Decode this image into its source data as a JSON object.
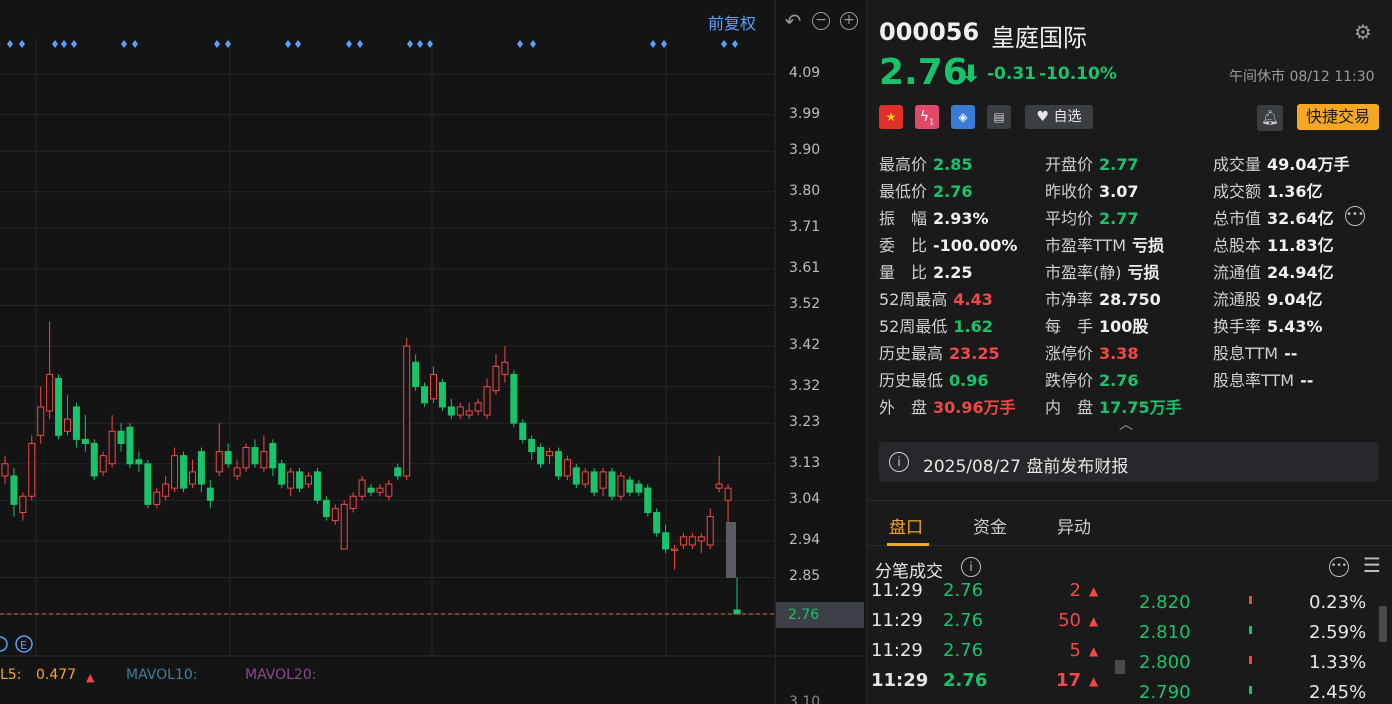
{
  "toolbar": {
    "adjust_label": "前复权",
    "undo_icon": "undo-icon",
    "zoom_out_icon": "zoom-out-icon",
    "zoom_in_icon": "zoom-in-icon"
  },
  "chart_data": {
    "type": "candlestick",
    "title": "",
    "y_ticks": [
      "4.09",
      "3.99",
      "3.90",
      "3.80",
      "3.71",
      "3.61",
      "3.52",
      "3.42",
      "3.32",
      "3.23",
      "3.13",
      "3.04",
      "2.94",
      "2.85",
      "2.76"
    ],
    "ylim": [
      2.76,
      4.09
    ],
    "current_price_label": "2.76",
    "partial_low_label": "3.10",
    "candles": [
      {
        "o": 3.1,
        "c": 3.13,
        "h": 3.15,
        "l": 3.08
      },
      {
        "o": 3.1,
        "c": 3.03,
        "h": 3.12,
        "l": 3.0
      },
      {
        "o": 3.01,
        "c": 3.05,
        "h": 3.06,
        "l": 2.99
      },
      {
        "o": 3.05,
        "c": 3.18,
        "h": 3.2,
        "l": 3.04
      },
      {
        "o": 3.2,
        "c": 3.27,
        "h": 3.32,
        "l": 3.18
      },
      {
        "o": 3.26,
        "c": 3.35,
        "h": 3.48,
        "l": 3.24
      },
      {
        "o": 3.34,
        "c": 3.2,
        "h": 3.35,
        "l": 3.19
      },
      {
        "o": 3.21,
        "c": 3.24,
        "h": 3.3,
        "l": 3.2
      },
      {
        "o": 3.27,
        "c": 3.19,
        "h": 3.28,
        "l": 3.17
      },
      {
        "o": 3.19,
        "c": 3.18,
        "h": 3.25,
        "l": 3.16
      },
      {
        "o": 3.18,
        "c": 3.1,
        "h": 3.19,
        "l": 3.09
      },
      {
        "o": 3.11,
        "c": 3.15,
        "h": 3.16,
        "l": 3.1
      },
      {
        "o": 3.13,
        "c": 3.21,
        "h": 3.25,
        "l": 3.12
      },
      {
        "o": 3.21,
        "c": 3.18,
        "h": 3.23,
        "l": 3.16
      },
      {
        "o": 3.22,
        "c": 3.13,
        "h": 3.23,
        "l": 3.12
      },
      {
        "o": 3.14,
        "c": 3.13,
        "h": 3.16,
        "l": 3.11
      },
      {
        "o": 3.13,
        "c": 3.03,
        "h": 3.14,
        "l": 3.02
      },
      {
        "o": 3.03,
        "c": 3.06,
        "h": 3.07,
        "l": 3.02
      },
      {
        "o": 3.05,
        "c": 3.08,
        "h": 3.1,
        "l": 3.04
      },
      {
        "o": 3.07,
        "c": 3.15,
        "h": 3.17,
        "l": 3.06
      },
      {
        "o": 3.15,
        "c": 3.07,
        "h": 3.16,
        "l": 3.06
      },
      {
        "o": 3.08,
        "c": 3.11,
        "h": 3.14,
        "l": 3.07
      },
      {
        "o": 3.16,
        "c": 3.08,
        "h": 3.17,
        "l": 3.06
      },
      {
        "o": 3.07,
        "c": 3.04,
        "h": 3.09,
        "l": 3.02
      },
      {
        "o": 3.11,
        "c": 3.16,
        "h": 3.23,
        "l": 3.1
      },
      {
        "o": 3.16,
        "c": 3.13,
        "h": 3.18,
        "l": 3.12
      },
      {
        "o": 3.1,
        "c": 3.12,
        "h": 3.14,
        "l": 3.09
      },
      {
        "o": 3.12,
        "c": 3.17,
        "h": 3.18,
        "l": 3.11
      },
      {
        "o": 3.17,
        "c": 3.13,
        "h": 3.19,
        "l": 3.12
      },
      {
        "o": 3.12,
        "c": 3.16,
        "h": 3.2,
        "l": 3.11
      },
      {
        "o": 3.18,
        "c": 3.12,
        "h": 3.19,
        "l": 3.1
      },
      {
        "o": 3.13,
        "c": 3.08,
        "h": 3.14,
        "l": 3.07
      },
      {
        "o": 3.07,
        "c": 3.11,
        "h": 3.12,
        "l": 3.05
      },
      {
        "o": 3.11,
        "c": 3.07,
        "h": 3.12,
        "l": 3.06
      },
      {
        "o": 3.08,
        "c": 3.1,
        "h": 3.11,
        "l": 3.07
      },
      {
        "o": 3.11,
        "c": 3.04,
        "h": 3.12,
        "l": 3.03
      },
      {
        "o": 3.04,
        "c": 3.0,
        "h": 3.05,
        "l": 2.99
      },
      {
        "o": 2.99,
        "c": 3.02,
        "h": 3.03,
        "l": 2.98
      },
      {
        "o": 2.92,
        "c": 3.03,
        "h": 3.04,
        "l": 2.92
      },
      {
        "o": 3.02,
        "c": 3.05,
        "h": 3.06,
        "l": 3.01
      },
      {
        "o": 3.05,
        "c": 3.09,
        "h": 3.1,
        "l": 3.04
      },
      {
        "o": 3.07,
        "c": 3.06,
        "h": 3.08,
        "l": 3.05
      },
      {
        "o": 3.06,
        "c": 3.07,
        "h": 3.08,
        "l": 3.05
      },
      {
        "o": 3.05,
        "c": 3.08,
        "h": 3.09,
        "l": 3.04
      },
      {
        "o": 3.12,
        "c": 3.1,
        "h": 3.13,
        "l": 3.09
      },
      {
        "o": 3.1,
        "c": 3.42,
        "h": 3.44,
        "l": 3.09
      },
      {
        "o": 3.38,
        "c": 3.32,
        "h": 3.4,
        "l": 3.31
      },
      {
        "o": 3.32,
        "c": 3.28,
        "h": 3.33,
        "l": 3.27
      },
      {
        "o": 3.29,
        "c": 3.35,
        "h": 3.37,
        "l": 3.28
      },
      {
        "o": 3.33,
        "c": 3.27,
        "h": 3.34,
        "l": 3.26
      },
      {
        "o": 3.27,
        "c": 3.25,
        "h": 3.29,
        "l": 3.24
      },
      {
        "o": 3.25,
        "c": 3.27,
        "h": 3.28,
        "l": 3.24
      },
      {
        "o": 3.25,
        "c": 3.26,
        "h": 3.28,
        "l": 3.24
      },
      {
        "o": 3.26,
        "c": 3.28,
        "h": 3.29,
        "l": 3.25
      },
      {
        "o": 3.25,
        "c": 3.32,
        "h": 3.34,
        "l": 3.24
      },
      {
        "o": 3.31,
        "c": 3.37,
        "h": 3.4,
        "l": 3.3
      },
      {
        "o": 3.35,
        "c": 3.38,
        "h": 3.42,
        "l": 3.33
      },
      {
        "o": 3.35,
        "c": 3.23,
        "h": 3.36,
        "l": 3.22
      },
      {
        "o": 3.23,
        "c": 3.19,
        "h": 3.24,
        "l": 3.18
      },
      {
        "o": 3.19,
        "c": 3.16,
        "h": 3.2,
        "l": 3.14
      },
      {
        "o": 3.17,
        "c": 3.13,
        "h": 3.18,
        "l": 3.12
      },
      {
        "o": 3.15,
        "c": 3.16,
        "h": 3.17,
        "l": 3.13
      },
      {
        "o": 3.16,
        "c": 3.1,
        "h": 3.17,
        "l": 3.09
      },
      {
        "o": 3.1,
        "c": 3.14,
        "h": 3.15,
        "l": 3.09
      },
      {
        "o": 3.12,
        "c": 3.08,
        "h": 3.13,
        "l": 3.07
      },
      {
        "o": 3.08,
        "c": 3.11,
        "h": 3.12,
        "l": 3.07
      },
      {
        "o": 3.11,
        "c": 3.06,
        "h": 3.12,
        "l": 3.05
      },
      {
        "o": 3.07,
        "c": 3.11,
        "h": 3.12,
        "l": 3.05
      },
      {
        "o": 3.11,
        "c": 3.05,
        "h": 3.12,
        "l": 3.04
      },
      {
        "o": 3.05,
        "c": 3.1,
        "h": 3.11,
        "l": 3.04
      },
      {
        "o": 3.09,
        "c": 3.06,
        "h": 3.1,
        "l": 3.05
      },
      {
        "o": 3.08,
        "c": 3.06,
        "h": 3.09,
        "l": 3.05
      },
      {
        "o": 3.07,
        "c": 3.01,
        "h": 3.08,
        "l": 3.0
      },
      {
        "o": 3.01,
        "c": 2.96,
        "h": 3.02,
        "l": 2.95
      },
      {
        "o": 2.96,
        "c": 2.92,
        "h": 2.98,
        "l": 2.91
      },
      {
        "o": 2.92,
        "c": 2.92,
        "h": 2.93,
        "l": 2.87
      },
      {
        "o": 2.93,
        "c": 2.95,
        "h": 2.96,
        "l": 2.92
      },
      {
        "o": 2.93,
        "c": 2.95,
        "h": 2.96,
        "l": 2.92
      },
      {
        "o": 2.94,
        "c": 2.95,
        "h": 2.96,
        "l": 2.91
      },
      {
        "o": 2.93,
        "c": 3.0,
        "h": 3.02,
        "l": 2.92
      },
      {
        "o": 3.07,
        "c": 3.08,
        "h": 3.15,
        "l": 3.06
      },
      {
        "o": 3.04,
        "c": 3.07,
        "h": 3.08,
        "l": 2.98
      },
      {
        "o": 2.77,
        "c": 2.76,
        "h": 2.85,
        "l": 2.76
      }
    ],
    "markers": [
      [
        10,
        22
      ],
      [
        55,
        64,
        74
      ],
      [
        124,
        135
      ],
      [
        217,
        228
      ],
      [
        288,
        298
      ],
      [
        349,
        360
      ],
      [
        410,
        420,
        430
      ],
      [
        520,
        533
      ],
      [
        653,
        664
      ],
      [
        724,
        735
      ]
    ]
  },
  "volume_legend": {
    "mavol5_label": "L5:",
    "mavol5_value": "0.477",
    "mavol10_label": "MAVOL10:",
    "mavol20_label": "MAVOL20:",
    "mavol5_color": "#f5a623",
    "mavol10_color": "#3f7f99",
    "mavol20_color": "#8a4a8a"
  },
  "quote": {
    "code": "000056",
    "name": "皇庭国际",
    "price": "2.76",
    "arrow": "⬇",
    "change": "-0.31",
    "change_pct": "-10.10%",
    "market_status": "午间休市 08/12 11:30",
    "favorite_label": "自选",
    "quick_trade_label": "快捷交易",
    "badges": [
      "china-flag-icon",
      "margin-icon",
      "tag-icon",
      "note-icon"
    ],
    "badge_margin_text": "1"
  },
  "stats": [
    [
      {
        "label": "最高价",
        "value": "2.85",
        "color": "g"
      },
      {
        "label": "开盘价",
        "value": "2.77",
        "color": "g"
      },
      {
        "label": "成交量",
        "value": "49.04万手",
        "color": "w"
      }
    ],
    [
      {
        "label": "最低价",
        "value": "2.76",
        "color": "g"
      },
      {
        "label": "昨收价",
        "value": "3.07",
        "color": "w"
      },
      {
        "label": "成交额",
        "value": "1.36亿",
        "color": "w"
      }
    ],
    [
      {
        "label": "振　幅",
        "value": "2.93%",
        "color": "w"
      },
      {
        "label": "平均价",
        "value": "2.77",
        "color": "g"
      },
      {
        "label": "总市值",
        "value": "32.64亿",
        "color": "w"
      }
    ],
    [
      {
        "label": "委　比",
        "value": "-100.00%",
        "color": "w"
      },
      {
        "label": "市盈率TTM",
        "value": "亏损",
        "color": "w"
      },
      {
        "label": "总股本",
        "value": "11.83亿",
        "color": "w"
      }
    ],
    [
      {
        "label": "量　比",
        "value": "2.25",
        "color": "w"
      },
      {
        "label": "市盈率(静)",
        "value": "亏损",
        "color": "w"
      },
      {
        "label": "流通值",
        "value": "24.94亿",
        "color": "w"
      }
    ],
    [
      {
        "label": "52周最高",
        "value": "4.43",
        "color": "r"
      },
      {
        "label": "市净率",
        "value": "28.750",
        "color": "w"
      },
      {
        "label": "流通股",
        "value": "9.04亿",
        "color": "w"
      }
    ],
    [
      {
        "label": "52周最低",
        "value": "1.62",
        "color": "g"
      },
      {
        "label": "每　手",
        "value": "100股",
        "color": "w"
      },
      {
        "label": "换手率",
        "value": "5.43%",
        "color": "w"
      }
    ],
    [
      {
        "label": "历史最高",
        "value": "23.25",
        "color": "r"
      },
      {
        "label": "涨停价",
        "value": "3.38",
        "color": "r"
      },
      {
        "label": "股息TTM",
        "value": "--",
        "color": "w"
      }
    ],
    [
      {
        "label": "历史最低",
        "value": "0.96",
        "color": "g"
      },
      {
        "label": "跌停价",
        "value": "2.76",
        "color": "g"
      },
      {
        "label": "股息率TTM",
        "value": "--",
        "color": "w"
      }
    ],
    [
      {
        "label": "外　盘",
        "value": "30.96万手",
        "color": "r"
      },
      {
        "label": "内　盘",
        "value": "17.75万手",
        "color": "g"
      }
    ]
  ],
  "notice": {
    "text": "2025/08/27  盘前发布财报"
  },
  "tabs": [
    {
      "label": "盘口",
      "active": true
    },
    {
      "label": "资金",
      "active": false
    },
    {
      "label": "异动",
      "active": false
    }
  ],
  "ticks_section": {
    "title": "分笔成交"
  },
  "ticks": [
    {
      "time": "11:29",
      "price": "2.76",
      "vol": "2"
    },
    {
      "time": "11:29",
      "price": "2.76",
      "vol": "50"
    },
    {
      "time": "11:29",
      "price": "2.76",
      "vol": "5"
    },
    {
      "time": "11:29",
      "price": "2.76",
      "vol": "17"
    }
  ],
  "price_dist": [
    {
      "price": "2.820",
      "pct": "0.23%",
      "color": "#f04848"
    },
    {
      "price": "2.810",
      "pct": "2.59%",
      "color": "#19c36b"
    },
    {
      "price": "2.800",
      "pct": "1.33%",
      "color": "#f04848"
    },
    {
      "price": "2.790",
      "pct": "2.45%",
      "color": "#19c36b"
    }
  ]
}
